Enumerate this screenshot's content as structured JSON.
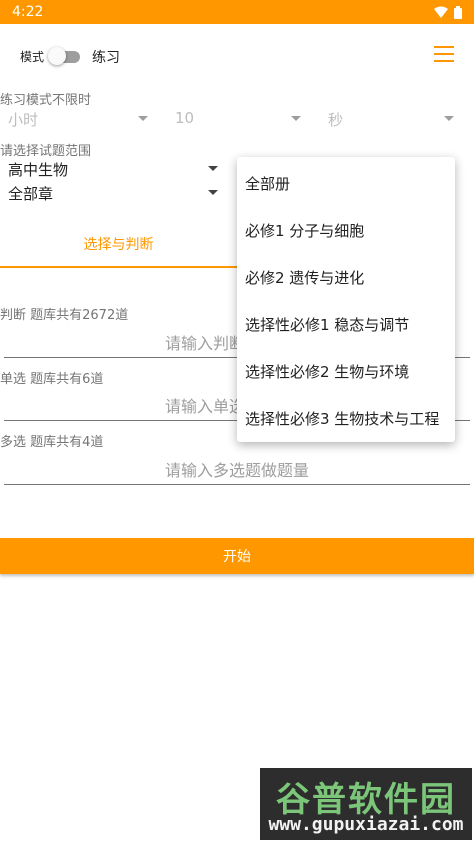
{
  "status_bar": {
    "time": "4:22",
    "icons": [
      "wifi-icon",
      "battery-icon"
    ]
  },
  "header": {
    "mode_label": "模式",
    "practice_label": "练习",
    "menu_icon": "hamburger-menu-icon",
    "accent_color": "#ff9800"
  },
  "time_limit": {
    "label": "练习模式不限时",
    "hour_value": "小时",
    "minute_value": "10",
    "second_value": "秒"
  },
  "scope": {
    "label": "请选择试题范围",
    "subject": "高中生物",
    "chapter": "全部章"
  },
  "tabs": [
    {
      "label": "选择与判断",
      "selected": true
    }
  ],
  "questions": {
    "judge": {
      "label": "判断 题库共有2672道",
      "placeholder": "请输入判断题做题量"
    },
    "single": {
      "label": "单选 题库共有6道",
      "placeholder": "请输入单选题做题量"
    },
    "multi": {
      "label": "多选 题库共有4道",
      "placeholder": "请输入多选题做题量"
    }
  },
  "start_button": {
    "label": "开始"
  },
  "dropdown": {
    "items": [
      "全部册",
      "必修1 分子与细胞",
      "必修2 遗传与进化",
      "选择性必修1 稳态与调节",
      "选择性必修2 生物与环境",
      "选择性必修3 生物技术与工程"
    ]
  },
  "watermark": {
    "logo_text": "谷普软件园",
    "url": "www.gupuxiazai.com"
  }
}
